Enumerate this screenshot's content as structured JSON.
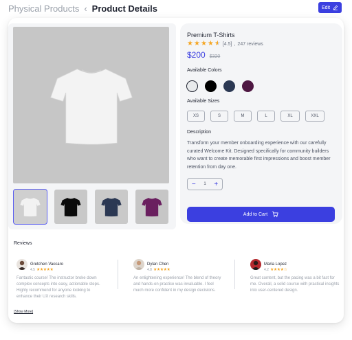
{
  "breadcrumb": {
    "parent": "Physical Products",
    "separator": "‹",
    "current": "Product Details"
  },
  "header": {
    "edit_label": "Edit",
    "edit_icon": "pencil-icon"
  },
  "product": {
    "title": "Premium T-Shirts",
    "rating": 4.5,
    "rating_text": "[4.5]",
    "reviews_count": "247 reviews",
    "price": "$200",
    "old_price": "$320",
    "colors_label": "Available Colors",
    "colors": [
      {
        "name": "white",
        "hex": "#e8eaec"
      },
      {
        "name": "black",
        "hex": "#000000"
      },
      {
        "name": "navy",
        "hex": "#2b3853"
      },
      {
        "name": "purple",
        "hex": "#4e1742"
      }
    ],
    "sizes_label": "Available Sizes",
    "sizes": [
      "XS",
      "S",
      "M",
      "L",
      "XL",
      "XXL"
    ],
    "description_label": "Description",
    "description": "Transform your member onboarding experience with our carefully curated Welcome Kit. Designed specifically for community builders who want to create memorable first impressions and boost member retention from day one.",
    "quantity": "1",
    "minus_label": "−",
    "plus_label": "+",
    "add_to_cart_label": "Add to Cart"
  },
  "gallery": {
    "main_shirt_color": "#f3f3f3",
    "thumbnails": [
      {
        "color": "shirt-white",
        "shirt": "#f2f2f2",
        "bg": "#cfcfcf"
      },
      {
        "color": "shirt-black",
        "shirt": "#0a0a0a",
        "bg": "#c8c8c8"
      },
      {
        "color": "shirt-navy",
        "shirt": "#2b3853",
        "bg": "#c9c9c9"
      },
      {
        "color": "shirt-purple",
        "shirt": "#6a1f5f",
        "bg": "#c6c6c6"
      }
    ]
  },
  "reviews": {
    "title": "Reviews",
    "items": [
      {
        "name": "Gretchen Vaccaro",
        "rating": "4.5",
        "stars": "★★★★★",
        "text": "Fantastic course! The instructor broke down complex concepts into easy, actionable steps. Highly recommend for anyone looking to enhance their UX research skills."
      },
      {
        "name": "Dylan Chen",
        "rating": "4.8",
        "stars": "★★★★★",
        "text": "An enlightening experience! The blend of theory and hands-on practice was invaluable. I feel much more confident in my design decisions."
      },
      {
        "name": "Maria Lopez",
        "rating": "4.2",
        "stars": "★★★★☆",
        "text": "Great content, but the pacing was a bit fast for me. Overall, a solid course with practical insights into user-centered design."
      }
    ],
    "show_more": "Show More"
  },
  "colors": {
    "accent": "#3b3fe0",
    "star": "#f5a623"
  }
}
